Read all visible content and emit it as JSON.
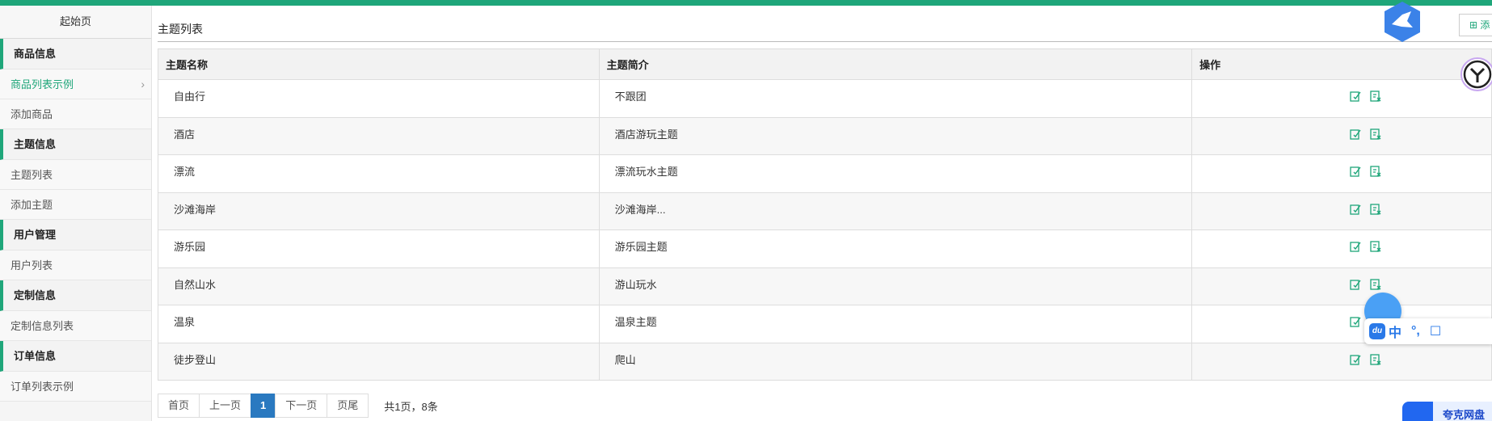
{
  "sidebar": {
    "start": "起始页",
    "groups": [
      {
        "title": "商品信息",
        "items": [
          {
            "label": "商品列表示例",
            "active": true
          },
          {
            "label": "添加商品",
            "active": false
          }
        ]
      },
      {
        "title": "主题信息",
        "items": [
          {
            "label": "主题列表",
            "active": false
          },
          {
            "label": "添加主题",
            "active": false
          }
        ]
      },
      {
        "title": "用户管理",
        "items": [
          {
            "label": "用户列表",
            "active": false
          }
        ]
      },
      {
        "title": "定制信息",
        "items": [
          {
            "label": "定制信息列表",
            "active": false
          }
        ]
      },
      {
        "title": "订单信息",
        "items": [
          {
            "label": "订单列表示例",
            "active": false
          }
        ]
      }
    ]
  },
  "main": {
    "title": "主题列表",
    "add_button": "添",
    "columns": [
      "主题名称",
      "主题简介",
      "操作"
    ],
    "rows": [
      {
        "name": "自由行",
        "intro": "不跟团"
      },
      {
        "name": "酒店",
        "intro": "酒店游玩主题"
      },
      {
        "name": "漂流",
        "intro": "漂流玩水主题"
      },
      {
        "name": "沙滩海岸",
        "intro": "沙滩海岸..."
      },
      {
        "name": "游乐园",
        "intro": "游乐园主题"
      },
      {
        "name": "自然山水",
        "intro": "游山玩水"
      },
      {
        "name": "温泉",
        "intro": "温泉主题"
      },
      {
        "name": "徒步登山",
        "intro": "爬山"
      }
    ],
    "row_actions": [
      {
        "icon": "edit-icon",
        "label": "编辑"
      },
      {
        "icon": "delete-icon",
        "label": "删除"
      }
    ]
  },
  "pager": {
    "first": "首页",
    "prev": "上一页",
    "current": "1",
    "next": "下一页",
    "last": "页尾",
    "info": "共1页，8条"
  },
  "overlays": {
    "ime": {
      "logo": "du",
      "items": [
        "中",
        "°,"
      ]
    },
    "quark": "夸克网盘"
  },
  "colors": {
    "accent": "#1fa67a",
    "pager_current": "#2a79c0",
    "topbar": "#1fa67a"
  }
}
